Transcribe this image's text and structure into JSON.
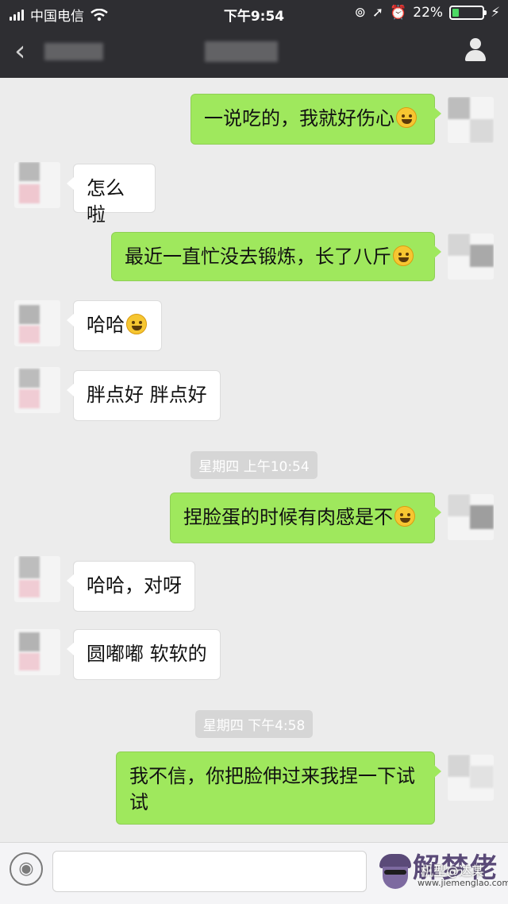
{
  "status_bar": {
    "carrier": "中国电信",
    "time": "下午9:54",
    "battery": "22%",
    "battery_level": 0.22
  },
  "nav": {
    "back_icon": "chevron-left-icon",
    "profile_icon": "person-icon"
  },
  "messages": [
    {
      "side": "out",
      "text": "一说吃的，我就好伤心",
      "emoji": "grimace-emoji"
    },
    {
      "side": "in",
      "text": "怎么啦"
    },
    {
      "side": "out",
      "text": "最近一直忙没去锻炼，长了八斤",
      "emoji": "laugh-cry-emoji"
    },
    {
      "side": "in",
      "text": "哈哈",
      "emoji": "grin-emoji"
    },
    {
      "side": "in",
      "text": "胖点好 胖点好"
    },
    {
      "timestamp": "星期四 上午10:54"
    },
    {
      "side": "out",
      "text": "捏脸蛋的时候有肉感是不",
      "emoji": "smile-emoji"
    },
    {
      "side": "in",
      "text": "哈哈，对呀"
    },
    {
      "side": "in",
      "text": "圆嘟嘟 软软的"
    },
    {
      "timestamp": "星期四 下午4:58"
    },
    {
      "side": "out",
      "text": "我不信，你把脸伸过来我捏一下试试"
    }
  ],
  "input_bar": {
    "voice_icon": "voice-icon",
    "watermark_brand": "解梦佬",
    "watermark_overlay": "机型@达某",
    "watermark_url": "www.jiemenglao.com"
  },
  "colors": {
    "nav_bg": "#2e2e32",
    "chat_bg": "#ececec",
    "outgoing_bubble": "#9fe85d",
    "incoming_bubble": "#ffffff",
    "timestamp_bg": "#d6d6d6"
  }
}
